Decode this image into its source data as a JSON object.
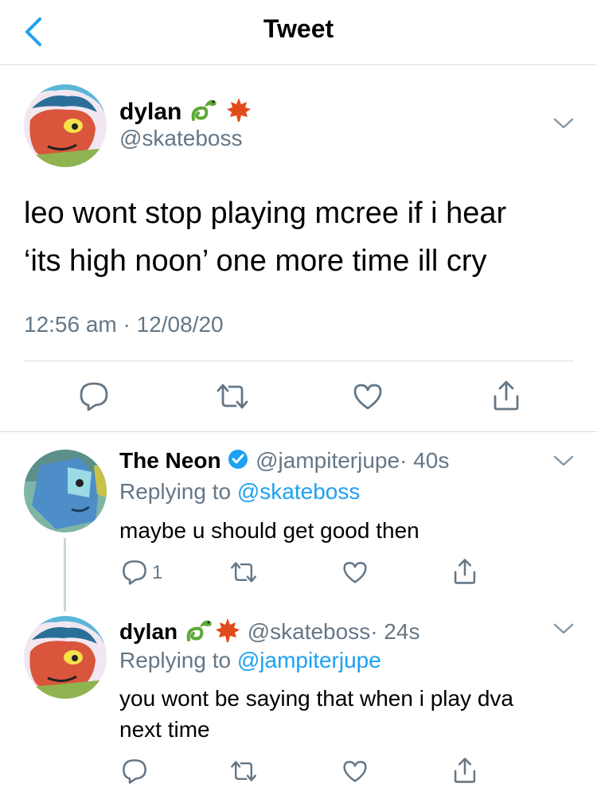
{
  "nav": {
    "title": "Tweet"
  },
  "main_tweet": {
    "name": "dylan",
    "handle": "@skateboss",
    "text_line1": "leo wont stop playing mcree if i hear",
    "text_line2": "‘its high noon’ one more time ill cry",
    "time": "12:56 am · 12/08/20"
  },
  "replies": [
    {
      "name": "The Neon",
      "handle": "@jampiterjupe",
      "age": "· 40s",
      "replying_prefix": "Replying to",
      "replying_to": "@skateboss",
      "text": "maybe u should get good then",
      "reply_count": "1"
    },
    {
      "name": "dylan",
      "handle": "@skateboss",
      "age": "· 24s",
      "replying_prefix": "Replying to",
      "replying_to": "@jampiterjupe",
      "text_line1": "you wont be saying that when i play dva",
      "text_line2": "next time"
    }
  ],
  "colors": {
    "accent": "#1da1f2",
    "muted": "#657786",
    "divider": "#d6d9dc",
    "verified": "#1da1f2"
  }
}
